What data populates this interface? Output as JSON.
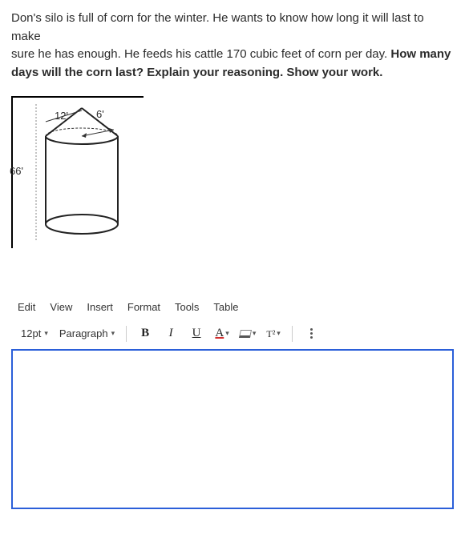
{
  "prompt": {
    "line1": "Don's silo is full of corn for the winter. He wants to know how long it will last to make",
    "line2": "sure he has enough. He feeds his cattle 170 cubic feet of corn per day. ",
    "bold1": "How many",
    "bold2": "days will the corn last? Explain your reasoning. Show your work."
  },
  "diagram": {
    "height_label": "66'",
    "width_label": "12'",
    "radius_label": "6'"
  },
  "editor": {
    "menus": [
      "Edit",
      "View",
      "Insert",
      "Format",
      "Tools",
      "Table"
    ],
    "font_size": "12pt",
    "block_format": "Paragraph",
    "bold": "B",
    "italic": "I",
    "underline": "U",
    "text_color_glyph": "A",
    "script_glyph": "T²",
    "content": ""
  },
  "chart_data": {
    "type": "diagram",
    "description": "Cylindrical silo with conical top",
    "total_height_ft": 66,
    "cylinder_diameter_ft": 12,
    "cone_radius_ft": 6,
    "feed_rate_cubic_ft_per_day": 170
  }
}
